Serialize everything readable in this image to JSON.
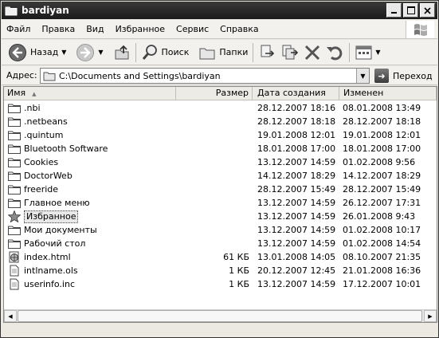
{
  "window": {
    "title": "bardiyan"
  },
  "menu": [
    "Файл",
    "Правка",
    "Вид",
    "Избранное",
    "Сервис",
    "Справка"
  ],
  "toolbar": {
    "back_label": "Назад",
    "search_label": "Поиск",
    "folders_label": "Папки"
  },
  "address": {
    "label": "Адрес:",
    "value": "C:\\Documents and Settings\\bardiyan",
    "go_label": "Переход"
  },
  "columns": {
    "name": "Имя",
    "size": "Размер",
    "created": "Дата создания",
    "modified": "Изменен"
  },
  "files": [
    {
      "name": ".nbi",
      "size": "",
      "created": "28.12.2007 18:16",
      "modified": "08.01.2008 13:49",
      "icon": "folder-icon"
    },
    {
      "name": ".netbeans",
      "size": "",
      "created": "28.12.2007 18:18",
      "modified": "28.12.2007 18:18",
      "icon": "folder-icon"
    },
    {
      "name": ".quintum",
      "size": "",
      "created": "19.01.2008 12:01",
      "modified": "19.01.2008 12:01",
      "icon": "folder-icon"
    },
    {
      "name": "Bluetooth Software",
      "size": "",
      "created": "18.01.2008 17:00",
      "modified": "18.01.2008 17:00",
      "icon": "folder-icon"
    },
    {
      "name": "Cookies",
      "size": "",
      "created": "13.12.2007 14:59",
      "modified": "01.02.2008 9:56",
      "icon": "folder-icon"
    },
    {
      "name": "DoctorWeb",
      "size": "",
      "created": "14.12.2007 18:29",
      "modified": "14.12.2007 18:29",
      "icon": "folder-icon"
    },
    {
      "name": "freeride",
      "size": "",
      "created": "28.12.2007 15:49",
      "modified": "28.12.2007 15:49",
      "icon": "folder-icon"
    },
    {
      "name": "Главное меню",
      "size": "",
      "created": "13.12.2007 14:59",
      "modified": "26.12.2007 17:31",
      "icon": "folder-icon"
    },
    {
      "name": "Избранное",
      "size": "",
      "created": "13.12.2007 14:59",
      "modified": "26.01.2008 9:43",
      "icon": "favorites-star-icon",
      "selected": true
    },
    {
      "name": "Мои документы",
      "size": "",
      "created": "13.12.2007 14:59",
      "modified": "01.02.2008 10:17",
      "icon": "folder-icon"
    },
    {
      "name": "Рабочий стол",
      "size": "",
      "created": "13.12.2007 14:59",
      "modified": "01.02.2008 14:54",
      "icon": "folder-icon"
    },
    {
      "name": "index.html",
      "size": "61 КБ",
      "created": "13.01.2008 14:05",
      "modified": "08.10.2007 21:35",
      "icon": "html-file-icon"
    },
    {
      "name": "intlname.ols",
      "size": "1 КБ",
      "created": "20.12.2007 12:45",
      "modified": "21.01.2008 16:36",
      "icon": "file-icon"
    },
    {
      "name": "userinfo.inc",
      "size": "1 КБ",
      "created": "13.12.2007 14:59",
      "modified": "17.12.2007 10:01",
      "icon": "file-icon"
    }
  ]
}
